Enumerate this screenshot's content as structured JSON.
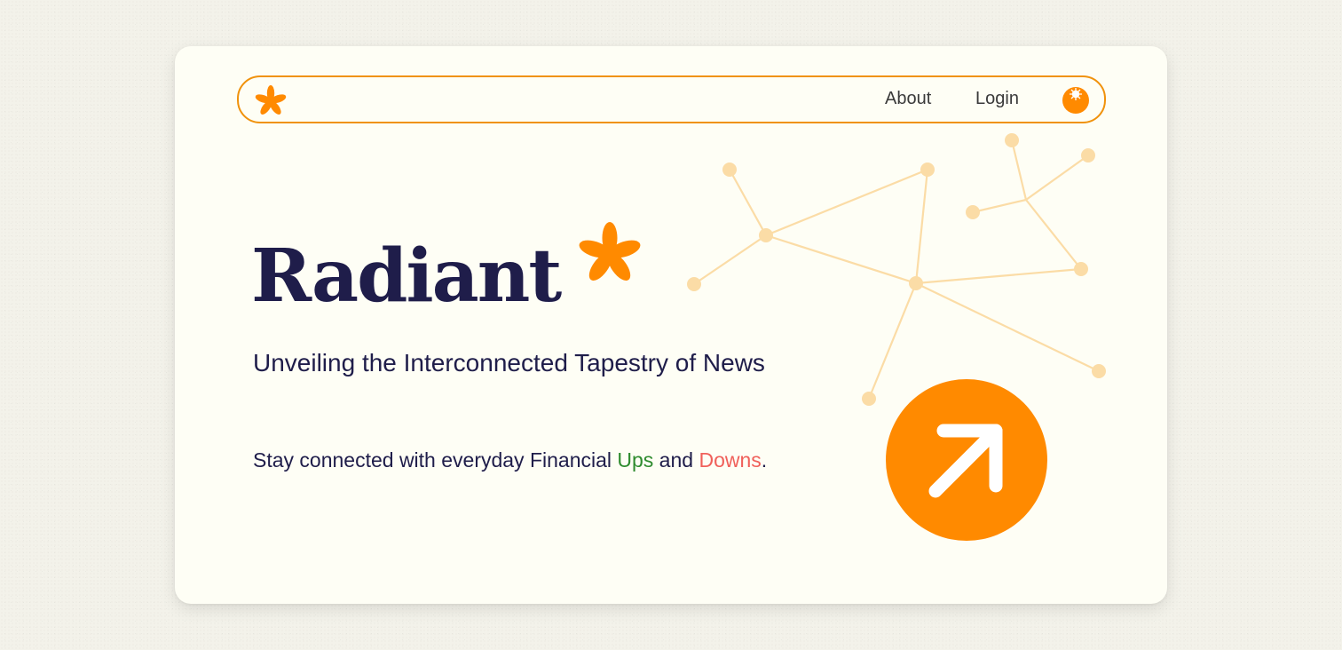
{
  "nav": {
    "logo_icon": "asterisk-logo-icon",
    "links": [
      {
        "label": "About"
      },
      {
        "label": "Login"
      }
    ],
    "avatar_icon": "avatar-sun-icon"
  },
  "hero": {
    "brand": "Radiant",
    "tagline": "Unveiling the Interconnected Tapestry of News",
    "subline": {
      "prefix": "Stay connected with everyday Financial ",
      "ups": "Ups",
      "middle": " and ",
      "downs": "Downs",
      "suffix": "."
    },
    "cta_icon": "arrow-up-right-icon"
  },
  "colors": {
    "accent": "#ff8a00",
    "accent_border": "#f0920c",
    "text_dark": "#1f1d4a",
    "ups": "#2e8b2e",
    "downs": "#f0605a",
    "network": "#fbdca6",
    "card_bg": "#fefef5"
  }
}
